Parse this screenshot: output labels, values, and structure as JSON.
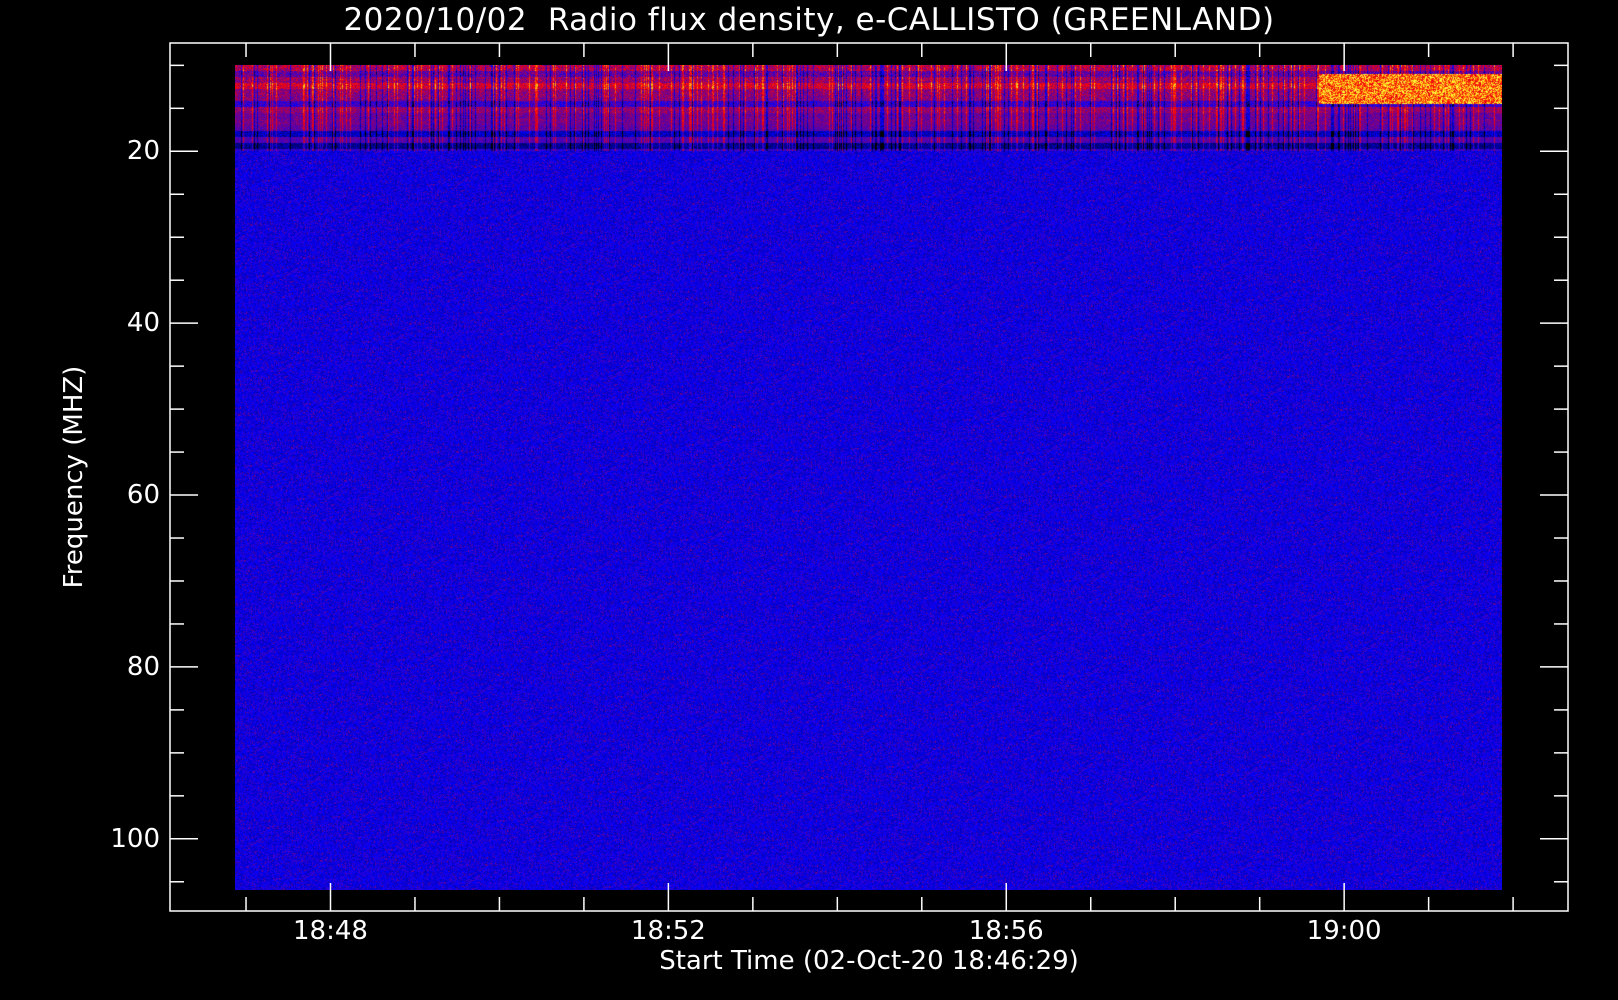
{
  "chart_data": {
    "type": "heatmap",
    "title": "2020/10/02  Radio flux density, e-CALLISTO (GREENLAND)",
    "xlabel": "Start Time (02-Oct-20 18:46:29)",
    "ylabel": "Frequency (MHZ)",
    "x_ticks": [
      "18:48",
      "18:52",
      "18:56",
      "19:00"
    ],
    "x_tick_minutes": [
      48,
      52,
      56,
      60
    ],
    "x_minor_step_minutes": 1,
    "y_ticks": [
      "20",
      "40",
      "60",
      "80",
      "100"
    ],
    "y_tick_values": [
      20,
      40,
      60,
      80,
      100
    ],
    "y_minor_step": 5,
    "xlim_minutes_after_1846": [
      0.1,
      16.65
    ],
    "data_time_range_minutes_after_1846": [
      0.87,
      15.87
    ],
    "ylim": [
      108.4,
      7.4
    ],
    "data_freq_range_mhz": [
      10,
      106
    ],
    "colormap": [
      "#000000",
      "#0000ff",
      "#800080",
      "#ff0000",
      "#ff8000",
      "#ffff00"
    ],
    "features": [
      {
        "label": "",
        "freq_mhz": [
          10,
          20
        ],
        "minutes_after_1846": [
          0.87,
          15.87
        ],
        "intensity": 0.55
      },
      {
        "label": "",
        "freq_mhz": [
          11,
          14.5
        ],
        "minutes_after_1846": [
          13.7,
          15.87
        ],
        "intensity": 0.9
      }
    ],
    "grid": false
  }
}
